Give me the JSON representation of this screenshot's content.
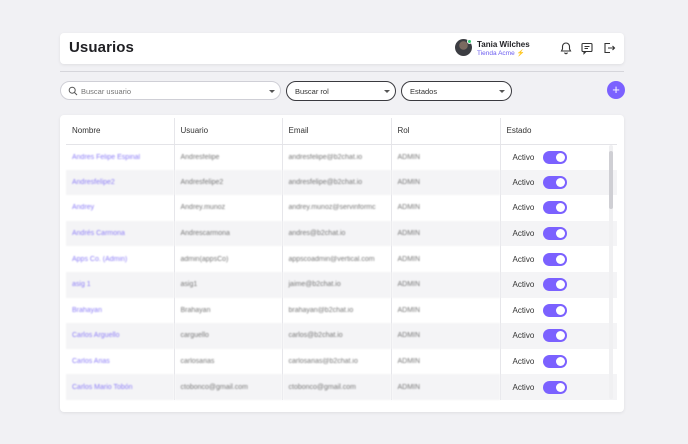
{
  "header": {
    "title": "Usuarios",
    "user_name": "Tania Wilches",
    "store": "Tienda Acme",
    "avatar_icon": "user-avatar",
    "icons": [
      "bell-icon",
      "chat-icon",
      "logout-icon"
    ]
  },
  "filters": {
    "search_placeholder": "Buscar usuario",
    "role_label": "Buscar rol",
    "status_label": "Estados"
  },
  "table": {
    "columns": [
      "Nombre",
      "Usuario",
      "Email",
      "Rol",
      "Estado"
    ],
    "rows": [
      {
        "nombre": "Andres Felipe Espinal",
        "usuario": "Andresfelipe",
        "email": "andresfelipe@b2chat.io",
        "rol": "ADMIN",
        "estado": "Activo",
        "active": true
      },
      {
        "nombre": "Andresfelipe2",
        "usuario": "Andresfelipe2",
        "email": "andresfelipe@b2chat.io",
        "rol": "ADMIN",
        "estado": "Activo",
        "active": true
      },
      {
        "nombre": "Andrey",
        "usuario": "Andrey.munoz",
        "email": "andrey.munoz@servinformc",
        "rol": "ADMIN",
        "estado": "Activo",
        "active": true
      },
      {
        "nombre": "Andrés Carmona",
        "usuario": "Andrescarmona",
        "email": "andres@b2chat.io",
        "rol": "ADMIN",
        "estado": "Activo",
        "active": true
      },
      {
        "nombre": "Apps Co. (Admin)",
        "usuario": "admin(appsCo)",
        "email": "appscoadmin@vertical.com",
        "rol": "ADMIN",
        "estado": "Activo",
        "active": true
      },
      {
        "nombre": "asig 1",
        "usuario": "asig1",
        "email": "jaime@b2chat.io",
        "rol": "ADMIN",
        "estado": "Activo",
        "active": true
      },
      {
        "nombre": "Brahayan",
        "usuario": "Brahayan",
        "email": "brahayan@b2chat.io",
        "rol": "ADMIN",
        "estado": "Activo",
        "active": true
      },
      {
        "nombre": "Carlos Arguello",
        "usuario": "carguello",
        "email": "carlos@b2chat.io",
        "rol": "ADMIN",
        "estado": "Activo",
        "active": true
      },
      {
        "nombre": "Carlos Arias",
        "usuario": "carlosarias",
        "email": "carlosarias@b2chat.io",
        "rol": "ADMIN",
        "estado": "Activo",
        "active": true
      },
      {
        "nombre": "Carlos Mario Tobón",
        "usuario": "ctobonco@gmail.com",
        "email": "ctobonco@gmail.com",
        "rol": "ADMIN",
        "estado": "Activo",
        "active": true
      }
    ]
  },
  "colors": {
    "accent": "#7b61ff",
    "link": "#8b7cf6",
    "online": "#2ecc71"
  }
}
